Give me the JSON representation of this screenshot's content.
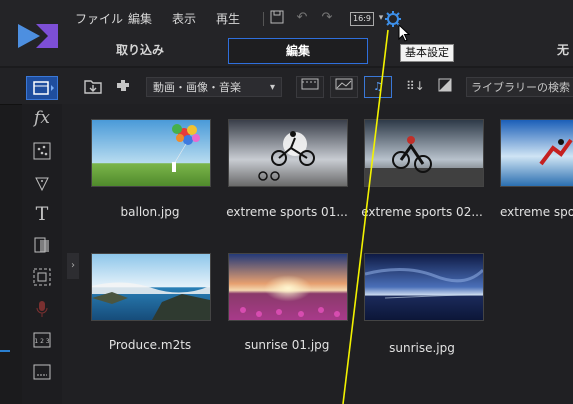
{
  "menu": {
    "items": [
      {
        "label": "ファイル"
      },
      {
        "label": "編集"
      },
      {
        "label": "表示"
      },
      {
        "label": "再生"
      }
    ],
    "aspect_ratio": "16:9"
  },
  "tabs": [
    {
      "label": "取り込み",
      "active": false
    },
    {
      "label": "編集",
      "active": true
    },
    {
      "label": "无",
      "active": false
    }
  ],
  "tooltip": {
    "text": "基本設定"
  },
  "toolbar": {
    "media_filter": "動画・画像・音楽",
    "search_placeholder": "ライブラリーの検索"
  },
  "media": [
    {
      "name": "ballon.jpg"
    },
    {
      "name": "extreme sports 01..."
    },
    {
      "name": "extreme sports 02..."
    },
    {
      "name": "extreme spo"
    },
    {
      "name": "Produce.m2ts"
    },
    {
      "name": "sunrise 01.jpg"
    },
    {
      "name": "sunrise.jpg"
    }
  ],
  "colors": {
    "accent": "#2f6fdc",
    "callout_line": "#f2f200",
    "background": "#1b1b1d"
  }
}
